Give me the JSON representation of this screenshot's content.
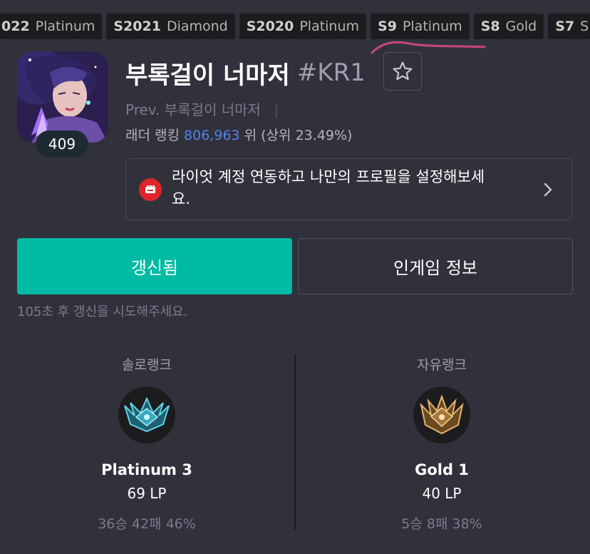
{
  "seasons": [
    {
      "code": "022",
      "tier": "Platinum"
    },
    {
      "code": "S2021",
      "tier": "Diamond"
    },
    {
      "code": "S2020",
      "tier": "Platinum"
    },
    {
      "code": "S9",
      "tier": "Platinum"
    },
    {
      "code": "S8",
      "tier": "Gold"
    },
    {
      "code": "S7",
      "tier": "Silv"
    }
  ],
  "profile": {
    "level": "409",
    "name": "부록걸이 너마저",
    "tag": "#KR1",
    "prev_label": "Prev.",
    "prev_name": "부록걸이 너마저",
    "prev_sep": "|",
    "ladder_label": "래더 랭킹",
    "ladder_rank": "806,963",
    "ladder_suffix": "위 (상위 23.49%)"
  },
  "riot_banner": {
    "text": "라이엇 계정 연동하고 나만의 프로필을 설정해보세요."
  },
  "buttons": {
    "update": "갱신됨",
    "ingame": "인게임 정보"
  },
  "retry_note": "105초 후 갱신을 시도해주세요.",
  "ranks": {
    "solo": {
      "queue": "솔로랭크",
      "tier": "Platinum 3",
      "lp": "69 LP",
      "record": "36승 42패 46%"
    },
    "flex": {
      "queue": "자유랭크",
      "tier": "Gold 1",
      "lp": "40 LP",
      "record": "5승 8패 38%"
    }
  },
  "colors": {
    "background": "#31313c",
    "accent": "#00bba3",
    "rank_link": "#5383e8",
    "riot_red": "#e0242b"
  },
  "icons": {
    "favorite": "star-icon",
    "riot": "riot-fist-icon",
    "banner_arrow": "chevron-right-icon",
    "solo_emblem": "platinum-emblem-icon",
    "flex_emblem": "gold-emblem-icon"
  }
}
